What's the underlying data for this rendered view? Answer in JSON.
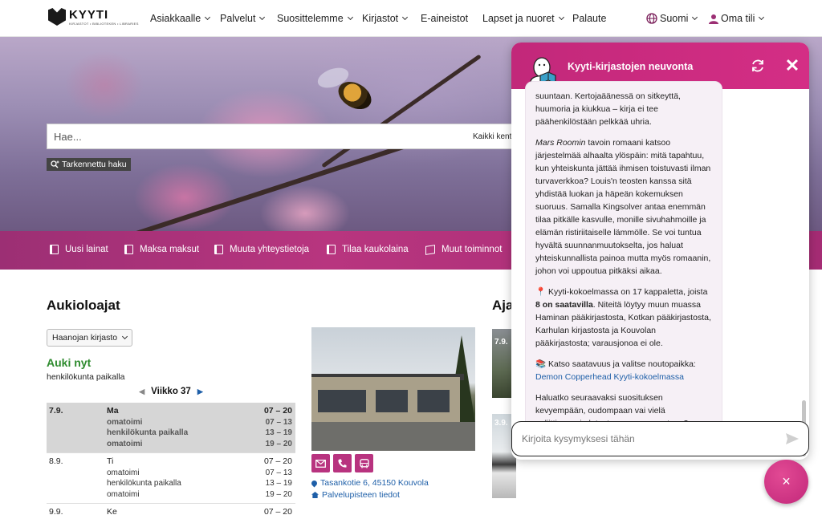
{
  "brand": {
    "name": "KYYTI",
    "tagline": "KIRJASTOT • BIBLIOTEKEN • LIBRARIES"
  },
  "nav": {
    "items": [
      {
        "label": "Asiakkaalle",
        "dropdown": true
      },
      {
        "label": "Palvelut",
        "dropdown": true
      },
      {
        "label": "Suosittelemme",
        "dropdown": true
      },
      {
        "label": "Kirjastot",
        "dropdown": true
      },
      {
        "label": "E-aineistot",
        "dropdown": false
      },
      {
        "label": "Lapset ja nuoret",
        "dropdown": true
      },
      {
        "label": "Palaute",
        "dropdown": false
      }
    ],
    "language": "Suomi",
    "account": "Oma tili"
  },
  "search": {
    "placeholder": "Hae...",
    "scope": "Kaikki kent",
    "advanced": "Tarkennettu haku"
  },
  "quick_links": [
    {
      "label": "Uusi lainat",
      "icon": "book-icon"
    },
    {
      "label": "Maksa maksut",
      "icon": "book-icon"
    },
    {
      "label": "Muuta yhteystietoja",
      "icon": "book-icon"
    },
    {
      "label": "Tilaa kaukolaina",
      "icon": "book-icon"
    },
    {
      "label": "Muut toiminnot",
      "icon": "box-icon"
    }
  ],
  "hours": {
    "title": "Aukioloajat",
    "library": "Haanojan kirjasto",
    "status": "Auki nyt",
    "status_sub": "henkilökunta paikalla",
    "week": "Viikko 37",
    "days": [
      {
        "date": "7.9.",
        "day": "Ma",
        "hours": "07 – 20",
        "current": true,
        "rows": [
          {
            "label": "omatoimi",
            "hours": "07 – 13"
          },
          {
            "label": "henkilökunta paikalla",
            "hours": "13 – 19"
          },
          {
            "label": "omatoimi",
            "hours": "19 – 20"
          }
        ]
      },
      {
        "date": "8.9.",
        "day": "Ti",
        "hours": "07 – 20",
        "current": false,
        "rows": [
          {
            "label": "omatoimi",
            "hours": "07 – 13"
          },
          {
            "label": "henkilökunta paikalla",
            "hours": "13 – 19"
          },
          {
            "label": "omatoimi",
            "hours": "19 – 20"
          }
        ]
      },
      {
        "date": "9.9.",
        "day": "Ke",
        "hours": "07 – 20",
        "current": false,
        "rows": []
      }
    ]
  },
  "library_card": {
    "address": "Tasankotie 6, 45150 Kouvola",
    "info_link": "Palvelupisteen tiedot",
    "contact_icons": [
      "mail-icon",
      "phone-icon",
      "bus-icon"
    ]
  },
  "news": {
    "title_partial": "Aja",
    "items": [
      {
        "date": "7.9."
      },
      {
        "date": "3.9."
      }
    ]
  },
  "chat": {
    "title": "Kyyti-kirjastojen neuvonta",
    "paragraphs": {
      "p1": "suuntaan. Kertojaäänessä on sitkeyttä, huumoria ja kiukkua – kirja ei tee päähenkilöstään pelkkää uhria.",
      "p2_em": "Mars Roomin",
      "p2_rest": " tavoin romaani katsoo järjestelmää alhaalta ylöspäin: mitä tapahtuu, kun yhteiskunta jättää ihmisen toistuvasti ilman turvaverkkoa? Louis'n teosten kanssa sitä yhdistää luokan ja häpeän kokemuksen suoruus. Samalla Kingsolver antaa enemmän tilaa pitkälle kasvulle, monille sivuhahmoille ja elämän ristiriitaiselle lämmölle. Se voi tuntua hyvältä suunnanmuutokselta, jos haluat yhteiskunnallista painoa mutta myös romaanin, johon voi uppoutua pitkäksi aikaa.",
      "p3_start": "📍 Kyyti-kokoelmassa on 17 kappaletta, joista ",
      "p3_bold": "8 on saatavilla",
      "p3_rest": ". Niteitä löytyy muun muassa Haminan pääkirjastosta, Kotkan pääkirjastosta, Karhulan kirjastosta ja Kouvolan pääkirjastosta; varausjonoa ei ole.",
      "p4_start": "📚 Katso saatavuus ja valitse noutopaikka:",
      "p4_link": "Demon Copperhead Kyyti-kokoelmassa",
      "p5": "Haluatko seuraavaksi suosituksen kevyempään, oudompaan vai vielä poliittisemmin latautuneeseen suuntaan?"
    },
    "input_placeholder": "Kirjoita kysymyksesi tähän",
    "fab_label": "×"
  },
  "colors": {
    "brand_magenta": "#c2287a",
    "link_blue": "#1e5fa8",
    "open_green": "#2e8b2e"
  }
}
